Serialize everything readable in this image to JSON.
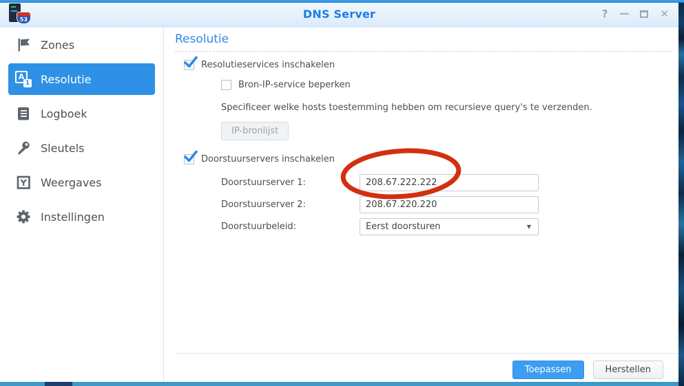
{
  "window": {
    "title": "DNS Server"
  },
  "app_icon": {
    "badge": "53"
  },
  "titlebar": {
    "controls": {
      "help": "?",
      "minimize": "—",
      "close": "✕"
    }
  },
  "sidebar": {
    "items": [
      {
        "label": "Zones",
        "icon": "flag-icon",
        "selected": false
      },
      {
        "label": "Resolutie",
        "icon": "translate-icon",
        "selected": true,
        "icon_letters": {
          "a": "A",
          "one": "1"
        }
      },
      {
        "label": "Logboek",
        "icon": "log-icon",
        "selected": false
      },
      {
        "label": "Sleutels",
        "icon": "key-icon",
        "selected": false
      },
      {
        "label": "Weergaves",
        "icon": "views-icon",
        "selected": false
      },
      {
        "label": "Instellingen",
        "icon": "gear-icon",
        "selected": false
      }
    ]
  },
  "content": {
    "heading": "Resolutie",
    "resolution_checkbox": {
      "label": "Resolutieservices inschakelen",
      "checked": true
    },
    "limit_checkbox": {
      "label": "Bron-IP-service beperken",
      "checked": false
    },
    "limit_description": "Specificeer welke hosts toestemming hebben om recursieve query's te verzenden.",
    "ip_source_button": "IP-bronlijst",
    "forwarders_checkbox": {
      "label": "Doorstuurservers inschakelen",
      "checked": true
    },
    "forwarder1": {
      "label": "Doorstuurserver 1:",
      "value": "208.67.222.222"
    },
    "forwarder2": {
      "label": "Doorstuurserver 2:",
      "value": "208.67.220.220"
    },
    "policy": {
      "label": "Doorstuurbeleid:",
      "value": "Eerst doorsturen",
      "caret": "▼"
    }
  },
  "footer": {
    "apply": "Toepassen",
    "reset": "Herstellen"
  },
  "annotation": {
    "shape": "hand-drawn-ellipse",
    "color": "#d2300f",
    "circles": [
      "208.67.222.222",
      "208.67.220.220"
    ]
  },
  "colors": {
    "accent_blue": "#2e91e5",
    "title_blue": "#1d7ee4",
    "heading_blue": "#3187e9",
    "apply_button": "#3d9df1",
    "annotation_red": "#d2300f"
  }
}
